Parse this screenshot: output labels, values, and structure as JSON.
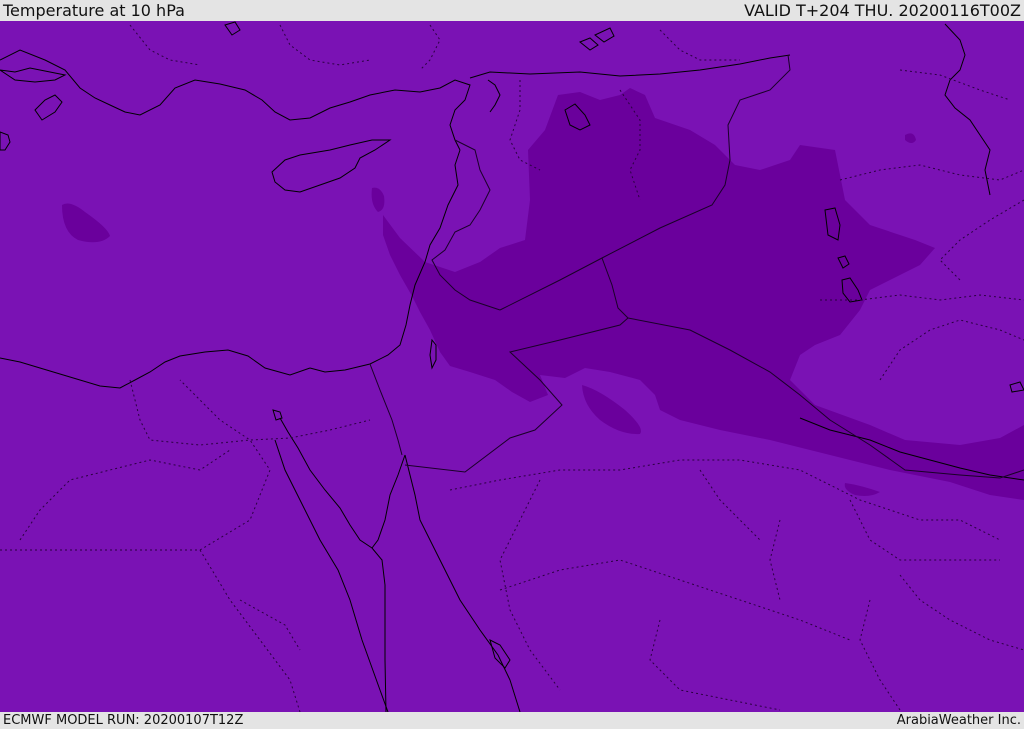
{
  "header": {
    "title": "Temperature at 10 hPa",
    "valid": "VALID T+204 THU. 20200116T00Z"
  },
  "footer": {
    "model_run": "ECMWF MODEL RUN: 20200107T12Z",
    "credit": "ArabiaWeather Inc."
  },
  "map": {
    "base_fill_color": "#7a12b4",
    "cold_region_color": "#6a009c",
    "coastline_color": "#000000",
    "border_color": "#2a0040"
  }
}
